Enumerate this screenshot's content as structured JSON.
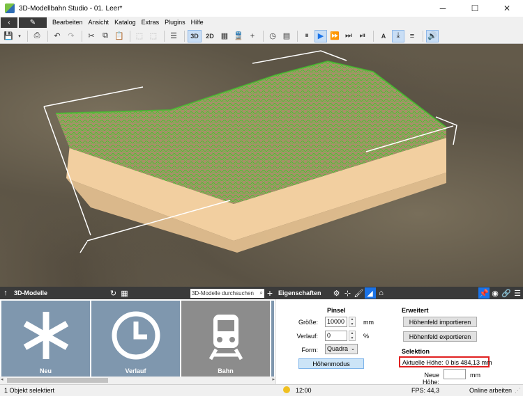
{
  "window": {
    "title": "3D-Modellbahn Studio - 01. Leer*",
    "minimize": "─",
    "maximize": "☐",
    "close": "✕"
  },
  "menu": {
    "back": "‹",
    "edit": "✎",
    "items": [
      "Bearbeiten",
      "Ansicht",
      "Katalog",
      "Extras",
      "Plugins",
      "Hilfe"
    ]
  },
  "toolbar": {
    "view_3d": "3D",
    "view_2d": "2D",
    "text_tool": "A"
  },
  "models_panel": {
    "title": "3D-Modelle",
    "search_placeholder": "3D-Modelle durchsuchen",
    "tiles": [
      {
        "label": "Neu",
        "icon": "asterisk-icon"
      },
      {
        "label": "Verlauf",
        "icon": "clock-icon"
      },
      {
        "label": "Bahn",
        "icon": "train-icon"
      }
    ]
  },
  "properties_panel": {
    "title": "Eigenschaften",
    "brush": {
      "heading": "Pinsel",
      "size_label": "Größe:",
      "size_value": "10000",
      "size_unit": "mm",
      "gradient_label": "Verlauf:",
      "gradient_value": "0",
      "gradient_unit": "%",
      "shape_label": "Form:",
      "shape_value": "Quadra",
      "mode_button": "Höhenmodus"
    },
    "advanced": {
      "heading": "Erweitert",
      "import_button": "Höhenfeld importieren",
      "export_button": "Höhenfeld exportieren"
    },
    "selection": {
      "heading": "Selektion",
      "current_height_label": "Aktuelle Höhe:",
      "current_height_value": "0 bis 484,13 mm",
      "new_height_label": "Neue Höhe:",
      "new_height_value": "",
      "new_height_unit": "mm"
    }
  },
  "statusbar": {
    "selection": "1 Objekt selektiert",
    "time": "12:00",
    "fps": "FPS: 44,3",
    "mode": "Online arbeiten"
  },
  "colors": {
    "accent": "#1a73e8",
    "tile": "#7f97ae",
    "terrain_green": "#3ecb2a",
    "highlight": "#e02020"
  }
}
